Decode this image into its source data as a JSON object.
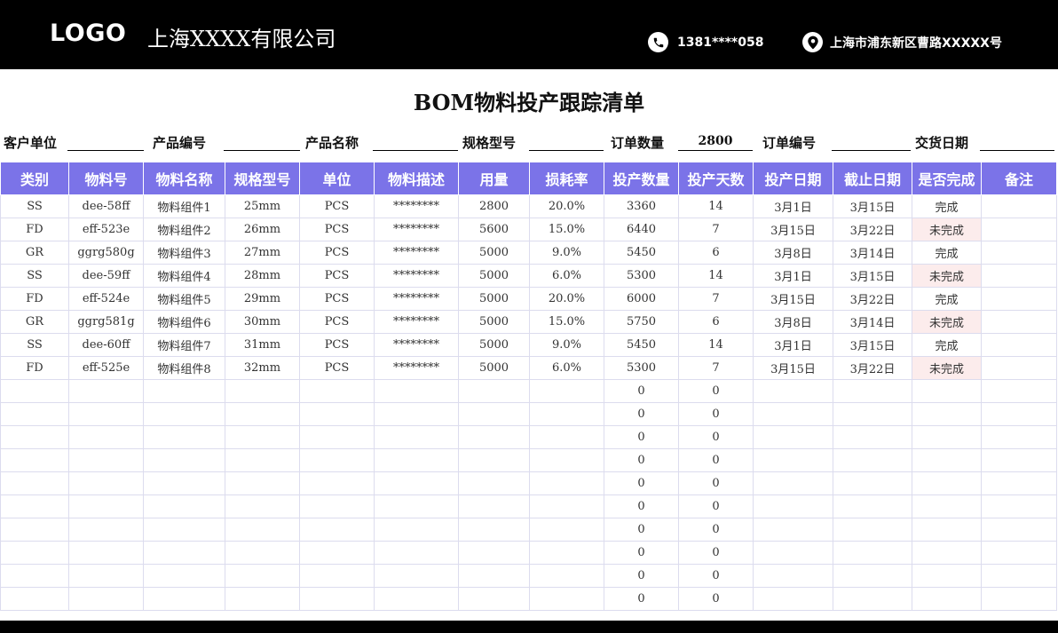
{
  "header": {
    "logo": "LOGO",
    "company": "上海XXXX有限公司",
    "phone": "1381****058",
    "address": "上海市浦东新区曹路XXXXX号"
  },
  "title": "BOM物料投产跟踪清单",
  "info": {
    "customer_label": "客户单位",
    "customer_value": "",
    "product_no_label": "产品编号",
    "product_no_value": "",
    "product_name_label": "产品名称",
    "product_name_value": "",
    "spec_label": "规格型号",
    "spec_value": "",
    "order_qty_label": "订单数量",
    "order_qty_value": "2800",
    "order_no_label": "订单编号",
    "order_no_value": "",
    "delivery_label": "交货日期",
    "delivery_value": ""
  },
  "table": {
    "columns": [
      "类别",
      "物料号",
      "物料名称",
      "规格型号",
      "单位",
      "物料描述",
      "用量",
      "损耗率",
      "投产数量",
      "投产天数",
      "投产日期",
      "截止日期",
      "是否完成",
      "备注"
    ],
    "rows": [
      [
        "SS",
        "dee-58ff",
        "物料组件1",
        "25mm",
        "PCS",
        "********",
        "2800",
        "20.0%",
        "3360",
        "14",
        "3月1日",
        "3月15日",
        "完成",
        ""
      ],
      [
        "FD",
        "eff-523e",
        "物料组件2",
        "26mm",
        "PCS",
        "********",
        "5600",
        "15.0%",
        "6440",
        "7",
        "3月15日",
        "3月22日",
        "未完成",
        ""
      ],
      [
        "GR",
        "ggrg580g",
        "物料组件3",
        "27mm",
        "PCS",
        "********",
        "5000",
        "9.0%",
        "5450",
        "6",
        "3月8日",
        "3月14日",
        "完成",
        ""
      ],
      [
        "SS",
        "dee-59ff",
        "物料组件4",
        "28mm",
        "PCS",
        "********",
        "5000",
        "6.0%",
        "5300",
        "14",
        "3月1日",
        "3月15日",
        "未完成",
        ""
      ],
      [
        "FD",
        "eff-524e",
        "物料组件5",
        "29mm",
        "PCS",
        "********",
        "5000",
        "20.0%",
        "6000",
        "7",
        "3月15日",
        "3月22日",
        "完成",
        ""
      ],
      [
        "GR",
        "ggrg581g",
        "物料组件6",
        "30mm",
        "PCS",
        "********",
        "5000",
        "15.0%",
        "5750",
        "6",
        "3月8日",
        "3月14日",
        "未完成",
        ""
      ],
      [
        "SS",
        "dee-60ff",
        "物料组件7",
        "31mm",
        "PCS",
        "********",
        "5000",
        "9.0%",
        "5450",
        "14",
        "3月1日",
        "3月15日",
        "完成",
        ""
      ],
      [
        "FD",
        "eff-525e",
        "物料组件8",
        "32mm",
        "PCS",
        "********",
        "5000",
        "6.0%",
        "5300",
        "7",
        "3月15日",
        "3月22日",
        "未完成",
        ""
      ],
      [
        "",
        "",
        "",
        "",
        "",
        "",
        "",
        "",
        "0",
        "0",
        "",
        "",
        "",
        ""
      ],
      [
        "",
        "",
        "",
        "",
        "",
        "",
        "",
        "",
        "0",
        "0",
        "",
        "",
        "",
        ""
      ],
      [
        "",
        "",
        "",
        "",
        "",
        "",
        "",
        "",
        "0",
        "0",
        "",
        "",
        "",
        ""
      ],
      [
        "",
        "",
        "",
        "",
        "",
        "",
        "",
        "",
        "0",
        "0",
        "",
        "",
        "",
        ""
      ],
      [
        "",
        "",
        "",
        "",
        "",
        "",
        "",
        "",
        "0",
        "0",
        "",
        "",
        "",
        ""
      ],
      [
        "",
        "",
        "",
        "",
        "",
        "",
        "",
        "",
        "0",
        "0",
        "",
        "",
        "",
        ""
      ],
      [
        "",
        "",
        "",
        "",
        "",
        "",
        "",
        "",
        "0",
        "0",
        "",
        "",
        "",
        ""
      ],
      [
        "",
        "",
        "",
        "",
        "",
        "",
        "",
        "",
        "0",
        "0",
        "",
        "",
        "",
        ""
      ],
      [
        "",
        "",
        "",
        "",
        "",
        "",
        "",
        "",
        "0",
        "0",
        "",
        "",
        "",
        ""
      ],
      [
        "",
        "",
        "",
        "",
        "",
        "",
        "",
        "",
        "0",
        "0",
        "",
        "",
        "",
        ""
      ]
    ]
  },
  "icons": {
    "phone": "phone-icon",
    "address": "location-pin-icon"
  },
  "colors": {
    "header_bg": "#000000",
    "table_header_bg": "#7b73e8",
    "pending_bg": "#fcecec"
  }
}
